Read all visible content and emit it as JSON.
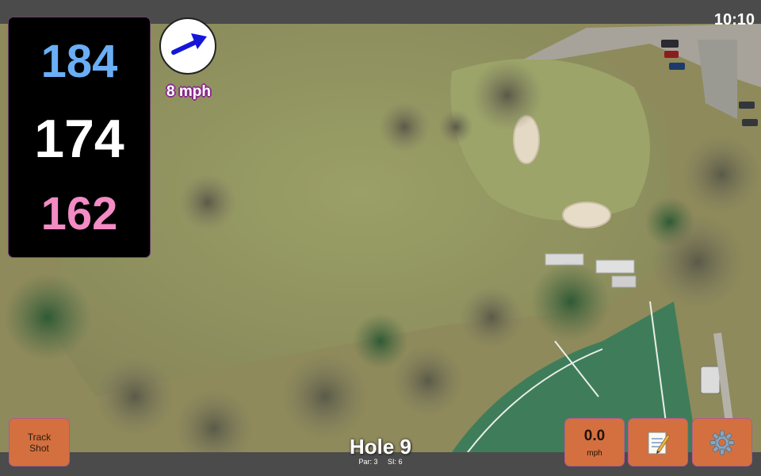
{
  "status_bar": {
    "time": "10:10"
  },
  "distances": {
    "back": "184",
    "middle": "174",
    "front": "162"
  },
  "wind": {
    "speed_label": "8 mph",
    "direction_icon": "arrow-icon"
  },
  "hole": {
    "title": "Hole 9",
    "par": "Par: 3",
    "stroke_index": "SI: 6"
  },
  "buttons": {
    "track_shot_line1": "Track",
    "track_shot_line2": "Shot",
    "speed_value": "0.0",
    "speed_unit": "mph",
    "notes_icon": "memo-icon",
    "settings_icon": "gear-icon"
  },
  "colors": {
    "back_distance": "#6aaef5",
    "middle_distance": "#ffffff",
    "front_distance": "#f38bc4",
    "button_fill": "#d4703f",
    "bar_gray": "#4b4b4b"
  }
}
